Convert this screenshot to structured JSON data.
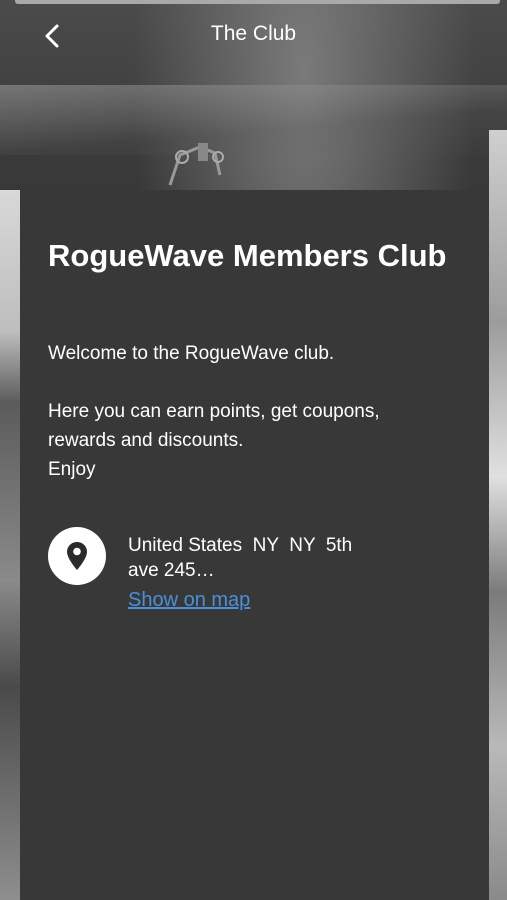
{
  "header": {
    "title": "The Club",
    "back_icon": "chevron-left-icon"
  },
  "club": {
    "name": "RogueWave Members Club",
    "description_lines": [
      "Welcome to the RogueWave club.",
      "Here you can earn points, get coupons,",
      "rewards and discounts.",
      "Enjoy"
    ]
  },
  "location": {
    "icon": "map-pin-icon",
    "address_line1": "United States  NY  NY  5th",
    "address_line2": "ave 245…",
    "map_link_label": "Show on map"
  },
  "colors": {
    "panel": "#383838",
    "link": "#4a90d9",
    "text": "#ffffff"
  }
}
